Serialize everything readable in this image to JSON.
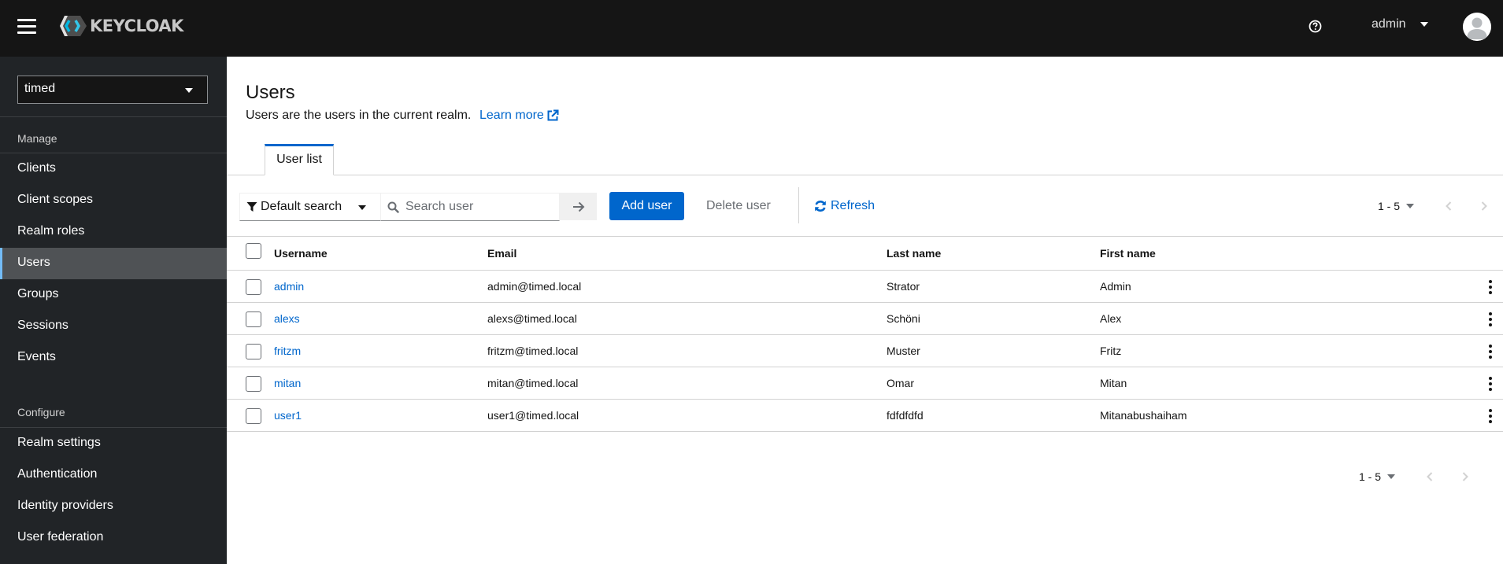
{
  "header": {
    "brand": "KEYCLOAK",
    "username": "admin",
    "icons": [
      "hamburger-menu-icon",
      "keycloak-logo-icon",
      "help-icon",
      "caret-down-icon",
      "avatar-icon"
    ]
  },
  "sidebar": {
    "realm": "timed",
    "sections": [
      {
        "title": "Manage",
        "items": [
          {
            "label": "Clients",
            "active": false
          },
          {
            "label": "Client scopes",
            "active": false
          },
          {
            "label": "Realm roles",
            "active": false
          },
          {
            "label": "Users",
            "active": true
          },
          {
            "label": "Groups",
            "active": false
          },
          {
            "label": "Sessions",
            "active": false
          },
          {
            "label": "Events",
            "active": false
          }
        ]
      },
      {
        "title": "Configure",
        "items": [
          {
            "label": "Realm settings",
            "active": false
          },
          {
            "label": "Authentication",
            "active": false
          },
          {
            "label": "Identity providers",
            "active": false
          },
          {
            "label": "User federation",
            "active": false
          }
        ]
      }
    ]
  },
  "page": {
    "title": "Users",
    "description": "Users are the users in the current realm.",
    "learn_more": "Learn more",
    "tabs": [
      {
        "label": "User list",
        "active": true
      }
    ]
  },
  "toolbar": {
    "filter_label": "Default search",
    "search_placeholder": "Search user",
    "search_value": "",
    "add_user": "Add user",
    "delete_user": "Delete user",
    "refresh": "Refresh",
    "pagination_range": "1 - 5"
  },
  "table": {
    "columns": [
      "Username",
      "Email",
      "Last name",
      "First name"
    ],
    "rows": [
      {
        "username": "admin",
        "email": "admin@timed.local",
        "last_name": "Strator",
        "first_name": "Admin"
      },
      {
        "username": "alexs",
        "email": "alexs@timed.local",
        "last_name": "Schöni",
        "first_name": "Alex"
      },
      {
        "username": "fritzm",
        "email": "fritzm@timed.local",
        "last_name": "Muster",
        "first_name": "Fritz"
      },
      {
        "username": "mitan",
        "email": "mitan@timed.local",
        "last_name": "Omar",
        "first_name": "Mitan"
      },
      {
        "username": "user1",
        "email": "user1@timed.local",
        "last_name": "fdfdfdfd",
        "first_name": "Mitanabushaiham"
      }
    ]
  },
  "footer": {
    "pagination_range": "1 - 5"
  },
  "colors": {
    "masthead": "#151515",
    "sidebar": "#212427",
    "sidebar_active": "#4f5255",
    "accent": "#0066cc",
    "active_marker": "#73bcf7"
  }
}
